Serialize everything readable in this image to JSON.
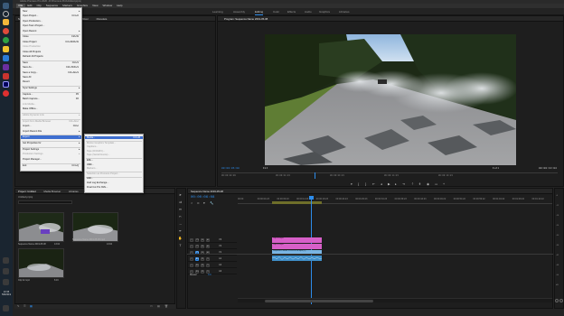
{
  "app": {
    "title": "Adobe Premiere Pro 2020 - D:\\Premiere Pro\\Untitled.prproj",
    "menu": [
      "File",
      "Edit",
      "Clip",
      "Sequence",
      "Markers",
      "Graphics",
      "View",
      "Window",
      "Help"
    ],
    "workspaces": [
      "Learning",
      "Assembly",
      "Editing",
      "Color",
      "Effects",
      "Audio",
      "Graphics",
      "Libraries"
    ],
    "active_workspace": "Editing"
  },
  "file_menu": {
    "items": [
      {
        "label": "New",
        "shortcut": "",
        "submenu": true,
        "disabled": false
      },
      {
        "label": "Open Project...",
        "shortcut": "Ctrl+O",
        "submenu": false,
        "disabled": false
      },
      {
        "label": "Open Production...",
        "shortcut": "",
        "submenu": false,
        "disabled": false
      },
      {
        "label": "Open Team Project...",
        "shortcut": "",
        "submenu": false,
        "disabled": false
      },
      {
        "label": "Open Recent",
        "shortcut": "",
        "submenu": true,
        "disabled": false
      },
      {
        "label": "Close",
        "shortcut": "Ctrl+W",
        "submenu": false,
        "disabled": false
      },
      {
        "label": "Close Project",
        "shortcut": "Ctrl+Shift+W",
        "submenu": false,
        "disabled": false
      },
      {
        "label": "Close Production",
        "shortcut": "",
        "submenu": false,
        "disabled": true
      },
      {
        "label": "Close All Projects",
        "shortcut": "",
        "submenu": false,
        "disabled": false
      },
      {
        "label": "Refresh All Projects",
        "shortcut": "",
        "submenu": false,
        "disabled": false
      },
      {
        "label": "Save",
        "shortcut": "Ctrl+S",
        "submenu": false,
        "disabled": false
      },
      {
        "label": "Save As...",
        "shortcut": "Ctrl+Shift+S",
        "submenu": false,
        "disabled": false
      },
      {
        "label": "Save a Copy...",
        "shortcut": "Ctrl+Alt+S",
        "submenu": false,
        "disabled": false
      },
      {
        "label": "Save All",
        "shortcut": "",
        "submenu": false,
        "disabled": false
      },
      {
        "label": "Revert",
        "shortcut": "",
        "submenu": false,
        "disabled": false
      },
      {
        "label": "Sync Settings",
        "shortcut": "",
        "submenu": true,
        "disabled": false
      },
      {
        "label": "Capture...",
        "shortcut": "F5",
        "submenu": false,
        "disabled": false
      },
      {
        "label": "Batch Capture...",
        "shortcut": "F6",
        "submenu": false,
        "disabled": false
      },
      {
        "label": "Link Media...",
        "shortcut": "",
        "submenu": false,
        "disabled": true
      },
      {
        "label": "Make Offline...",
        "shortcut": "",
        "submenu": false,
        "disabled": false
      },
      {
        "label": "Adobe Dynamic Link",
        "shortcut": "",
        "submenu": true,
        "disabled": true
      },
      {
        "label": "Import from Media Browser",
        "shortcut": "Ctrl+Alt+I",
        "submenu": false,
        "disabled": true
      },
      {
        "label": "Import...",
        "shortcut": "Ctrl+I",
        "submenu": false,
        "disabled": false
      },
      {
        "label": "Import Recent File",
        "shortcut": "",
        "submenu": true,
        "disabled": false
      },
      {
        "label": "Export",
        "shortcut": "",
        "submenu": true,
        "disabled": false,
        "highlighted": true
      },
      {
        "label": "Get Properties for",
        "shortcut": "",
        "submenu": true,
        "disabled": false
      },
      {
        "label": "Project Settings",
        "shortcut": "",
        "submenu": true,
        "disabled": false
      },
      {
        "label": "Production Settings",
        "shortcut": "",
        "submenu": true,
        "disabled": true
      },
      {
        "label": "Project Manager...",
        "shortcut": "",
        "submenu": false,
        "disabled": false
      },
      {
        "label": "Exit",
        "shortcut": "Ctrl+Q",
        "submenu": false,
        "disabled": false
      }
    ]
  },
  "export_menu": {
    "items": [
      {
        "label": "Media...",
        "shortcut": "Ctrl+M",
        "disabled": false,
        "highlighted": true
      },
      {
        "label": "Motion Graphics Template...",
        "shortcut": "",
        "disabled": true
      },
      {
        "label": "Captions...",
        "shortcut": "",
        "disabled": true
      },
      {
        "label": "Tape (DV/HDV)...",
        "shortcut": "",
        "disabled": true
      },
      {
        "label": "Tape (Serial Device)...",
        "shortcut": "",
        "disabled": true
      },
      {
        "label": "EDL...",
        "shortcut": "",
        "disabled": false
      },
      {
        "label": "OMF...",
        "shortcut": "",
        "disabled": false
      },
      {
        "label": "Markers...",
        "shortcut": "",
        "disabled": true
      },
      {
        "label": "Selection as Premiere Project...",
        "shortcut": "",
        "disabled": true
      },
      {
        "label": "AAF...",
        "shortcut": "",
        "disabled": false
      },
      {
        "label": "Avid Log Exchange...",
        "shortcut": "",
        "disabled": false
      },
      {
        "label": "Final Cut Pro XML...",
        "shortcut": "",
        "disabled": false
      }
    ]
  },
  "source_panel": {
    "tabs": [
      "Source: (no clips)",
      "Effect Controls",
      "Audio Clip Mixer",
      "Metadata"
    ]
  },
  "program_monitor": {
    "tab": "Program: Sequence Name 2019-05-08",
    "timecode": "00:00:06:08",
    "fit": "Fit",
    "quality": "Full",
    "duration": "00:00:13:04",
    "ruler": [
      "00:00:00:00",
      "00:00:04:23",
      "00:00:09:23",
      "00:00:14:23",
      "00:00:19:23"
    ]
  },
  "project_panel": {
    "tabs": [
      "Project: Untitled",
      "Media Browser",
      "Libraries"
    ],
    "path": "Untitled.prproj",
    "items": [
      {
        "name": "Sequence Name 2019-05-08",
        "duration": "13:04"
      },
      {
        "name": "Sequence Name 2019-05-08.mp4",
        "duration": "13:04"
      },
      {
        "name": "Clip 02.mp4",
        "duration": "6:16"
      }
    ]
  },
  "timeline": {
    "tab": "Sequence Name 2019-05-08",
    "timecode": "00:00:06:08",
    "ruler": [
      "00:00",
      "00:00:04:23",
      "00:00:09:23",
      "00:00:14:23",
      "00:00:19:23",
      "00:00:24:23",
      "00:00:29:23",
      "00:00:34:23",
      "00:00:39:23",
      "00:00:44:23",
      "00:00:49:22",
      "00:00:54:22",
      "00:00:59:22",
      "00:01:04:22",
      "00:01:09:22",
      "00:01:14:22"
    ],
    "tracks": [
      {
        "name": "V3",
        "type": "video"
      },
      {
        "name": "V2",
        "type": "video"
      },
      {
        "name": "V1",
        "type": "video"
      },
      {
        "name": "A1",
        "type": "audio"
      },
      {
        "name": "A2",
        "type": "audio"
      },
      {
        "name": "A3",
        "type": "audio"
      }
    ],
    "master_label": "Master",
    "master_value": "0.0",
    "clips": [
      {
        "label": "Clip 02.mp4",
        "track": "V3",
        "color": "#d75fc8"
      },
      {
        "label": "Clip 02.mp4",
        "track": "V2",
        "color": "#d75fc8"
      },
      {
        "label": "Sequence Name 2019-05-08.mp4 [V]",
        "track": "V1",
        "color": "#7ab5e3"
      },
      {
        "label": "",
        "track": "A1",
        "color": "#3f8fc9"
      }
    ]
  },
  "audio_meter": {
    "labels": [
      "-6",
      "-12",
      "-18",
      "-24",
      "-30",
      "-36",
      "-42",
      "-48",
      "-54",
      "dB"
    ]
  },
  "taskbar": {
    "time": "10:35",
    "date": "5/8/2019"
  }
}
